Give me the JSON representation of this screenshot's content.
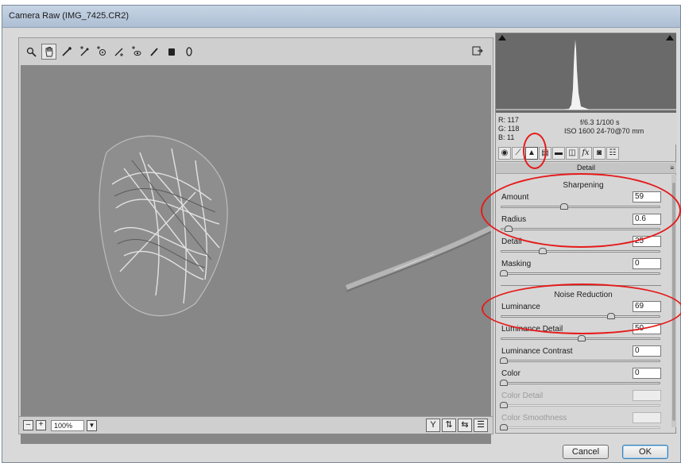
{
  "window": {
    "title": "Camera Raw (IMG_7425.CR2)"
  },
  "toolbar": {
    "tools": [
      {
        "name": "zoom-tool",
        "glyph": "🔍"
      },
      {
        "name": "hand-tool",
        "glyph": "✋"
      },
      {
        "name": "white-balance-tool",
        "glyph": "⁄"
      },
      {
        "name": "color-sampler-tool",
        "glyph": "⁄"
      },
      {
        "name": "targeted-adjustment-tool",
        "glyph": "⊙"
      },
      {
        "name": "crop-tool",
        "glyph": "⟋"
      },
      {
        "name": "red-eye-tool",
        "glyph": "⊕"
      },
      {
        "name": "adjustment-brush-tool",
        "glyph": "╱"
      },
      {
        "name": "graduated-filter-tool",
        "glyph": "▮"
      },
      {
        "name": "rotate-tool",
        "glyph": "◯"
      }
    ]
  },
  "zoom": {
    "value": "100%"
  },
  "info": {
    "r": "R:  117",
    "g": "G:  118",
    "b": "B:  11",
    "aperture_shutter": "f/6.3   1/100 s",
    "iso_lens": "ISO 1600   24-70@70 mm"
  },
  "panel": {
    "section_title": "Detail",
    "sharpening": {
      "title": "Sharpening",
      "sliders": [
        {
          "label": "Amount",
          "value": "59",
          "pos": 0.39
        },
        {
          "label": "Radius",
          "value": "0.6",
          "pos": 0.03
        },
        {
          "label": "Detail",
          "value": "25",
          "pos": 0.25
        },
        {
          "label": "Masking",
          "value": "0",
          "pos": 0.0
        }
      ]
    },
    "noise": {
      "title": "Noise Reduction",
      "sliders": [
        {
          "label": "Luminance",
          "value": "69",
          "pos": 0.69
        },
        {
          "label": "Luminance Detail",
          "value": "50",
          "pos": 0.5
        },
        {
          "label": "Luminance Contrast",
          "value": "0",
          "pos": 0.0
        },
        {
          "label": "Color",
          "value": "0",
          "pos": 0.0
        },
        {
          "label": "Color Detail",
          "value": "",
          "pos": 0.0,
          "disabled": true
        },
        {
          "label": "Color Smoothness",
          "value": "",
          "pos": 0.0,
          "disabled": true
        }
      ]
    }
  },
  "buttons": {
    "cancel": "Cancel",
    "ok": "OK"
  },
  "colors": {
    "annotation": "#e51b1b",
    "canvas": "#8a8a8a"
  }
}
